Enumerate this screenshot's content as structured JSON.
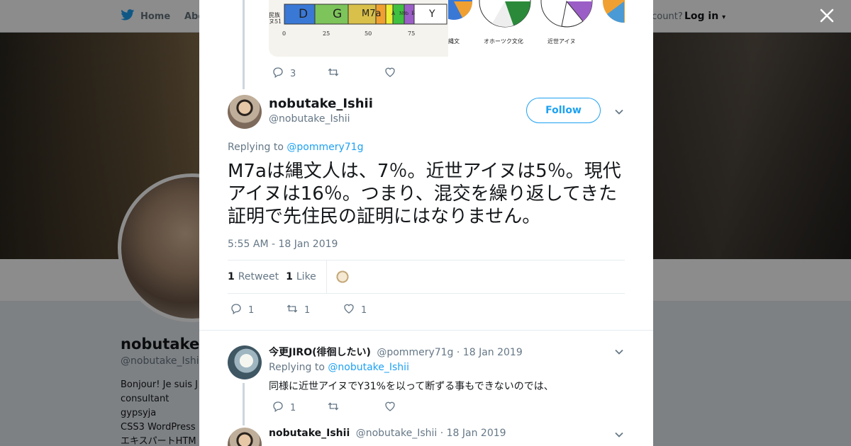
{
  "background_page": {
    "nav": {
      "home": "Home",
      "about": "Abo",
      "account_prompt": "ccount?",
      "login": "Log in"
    },
    "profile": {
      "name": "nobutake_I",
      "handle": "@nobutake_Ishii",
      "bio_lines": [
        "Bonjour! Je suis J",
        "consultant gypsyja",
        "CSS3 WordPress",
        "エキスパートHTM"
      ]
    }
  },
  "modal": {
    "previous_tweet": {
      "chart_labels": {
        "row_label_1": "民族",
        "row_label_2": "ヌ51",
        "segments": [
          "D",
          "G",
          "M7a",
          "A",
          "N9b",
          "B",
          "Y"
        ],
        "ticks": [
          "0",
          "25",
          "50",
          "75"
        ],
        "right_captions": [
          "縄文",
          "オホーツク文化",
          "近世アイヌ"
        ]
      },
      "reply_count": "3"
    },
    "main_tweet": {
      "author_name": "nobutake_Ishii",
      "author_handle": "@nobutake_Ishii",
      "follow_label": "Follow",
      "replying_prefix": "Replying to",
      "replying_to": "@pommery71g",
      "text": "M7aは縄文人は、7％。近世アイヌは5％。現代アイヌは16％。つまり、混交を繰り返してきた証明で先住民の証明にはなりません。",
      "timestamp": "5:55 AM - 18 Jan 2019",
      "retweets_count": "1",
      "retweets_label": "Retweet",
      "likes_count": "1",
      "likes_label": "Like",
      "action_reply_count": "1",
      "action_retweet_count": "1",
      "action_like_count": "1"
    },
    "replies": [
      {
        "author_name": "今更JIRO(徘徊したい)",
        "author_handle": "@pommery71g",
        "date": "· 18 Jan 2019",
        "replying_prefix": "Replying to",
        "replying_to": "@nobutake_Ishii",
        "text": "同様に近世アイヌでY31%を以って断ずる事もできないのでは、",
        "reply_count": "1"
      },
      {
        "author_name": "nobutake_Ishii",
        "author_handle": "@nobutake_Ishii",
        "date": "· 18 Jan 2019"
      }
    ]
  },
  "colors": {
    "twitter_blue": "#1da1f2",
    "secondary_text": "#657786",
    "thread_line": "#ccd6dd"
  }
}
